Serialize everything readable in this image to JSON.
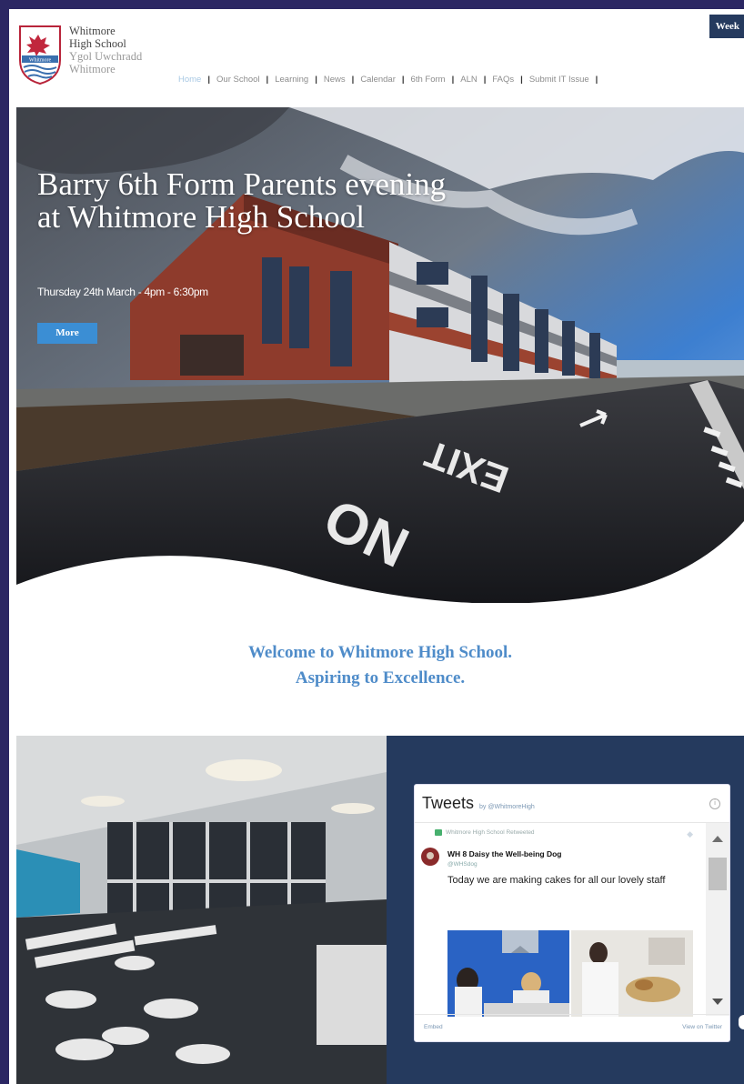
{
  "header": {
    "school_name_lines": [
      "Whitmore",
      "High School",
      "Ygol Uwchradd",
      "Whitmore"
    ],
    "crest_text": "Whitmore",
    "week_badge": "Week"
  },
  "nav": {
    "items": [
      {
        "label": "Home",
        "active": true
      },
      {
        "label": "Our School"
      },
      {
        "label": "Learning"
      },
      {
        "label": "News"
      },
      {
        "label": "Calendar"
      },
      {
        "label": "6th Form"
      },
      {
        "label": "ALN"
      },
      {
        "label": "FAQs"
      },
      {
        "label": "Submit IT Issue"
      }
    ],
    "separator": "|"
  },
  "hero": {
    "title": "Barry 6th Form Parents evening at Whitmore High School",
    "subtitle": "Thursday 24th March - 4pm - 6:30pm",
    "button_label": "More",
    "road_text_1": "EXIT",
    "road_text_2": "NO"
  },
  "welcome": {
    "line1": "Welcome to Whitmore High School.",
    "line2": "Aspiring to Excellence."
  },
  "tweets": {
    "title": "Tweets",
    "by": "by @WhitmoreHigh",
    "retweet_label": "Whitmore High School Retweeted",
    "author_name": "WH 8 Daisy the Well-being Dog",
    "author_handle": "@WHSdog",
    "text": "Today we are making cakes for all our lovely staff",
    "embed_label": "Embed",
    "view_label": "View on Twitter"
  },
  "colors": {
    "frame": "#2b2763",
    "navy": "#253a5e",
    "accent": "#4f8cc9",
    "button": "#3b8ed4"
  }
}
